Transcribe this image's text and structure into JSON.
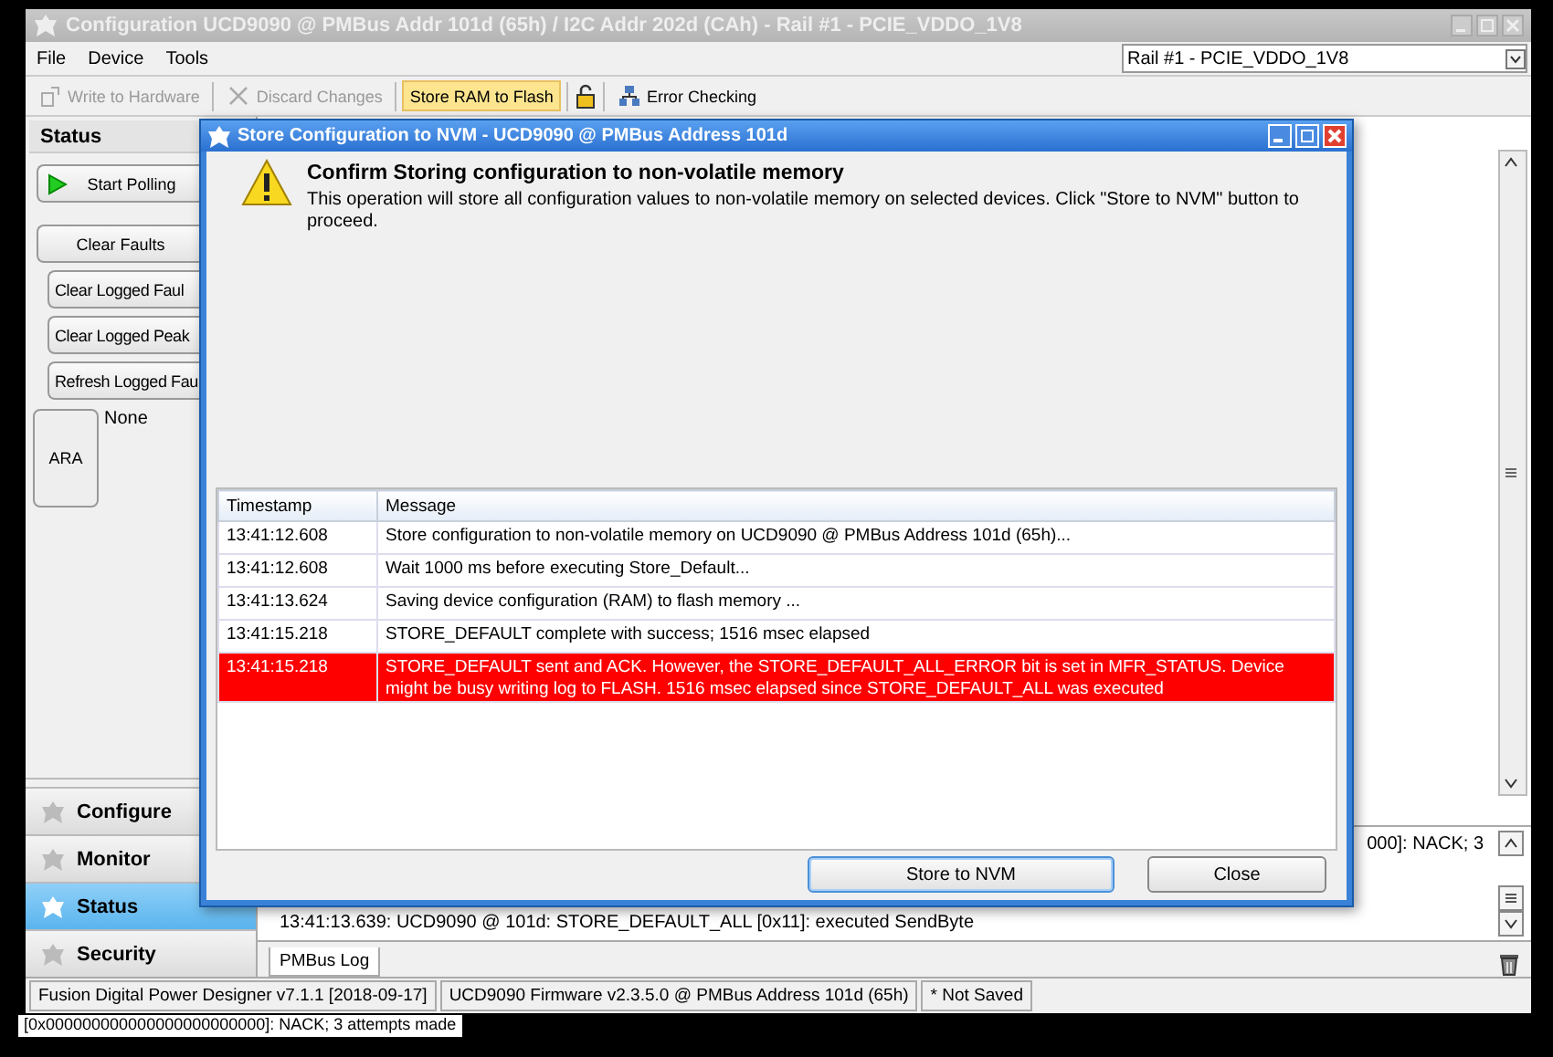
{
  "window": {
    "title": "Configuration UCD9090 @ PMBus Addr 101d (65h) / I2C Addr 202d (CAh) - Rail #1 - PCIE_VDDO_1V8"
  },
  "menu": [
    {
      "label": "File"
    },
    {
      "label": "Device"
    },
    {
      "label": "Tools"
    }
  ],
  "rail_select": {
    "value": "Rail #1 - PCIE_VDDO_1V8"
  },
  "toolbar": [
    {
      "kind": "button",
      "label": "Write to Hardware",
      "disabled": true,
      "highlighted": false
    },
    {
      "kind": "button",
      "label": "Discard Changes",
      "disabled": true,
      "highlighted": false
    },
    {
      "kind": "button",
      "label": "Store RAM to Flash",
      "disabled": false,
      "highlighted": true
    },
    {
      "kind": "icon"
    },
    {
      "kind": "button",
      "label": "Error Checking",
      "disabled": false,
      "highlighted": false
    }
  ],
  "status_panel": {
    "title": "Status",
    "buttons": [
      {
        "label": "Start Polling",
        "kind": "play"
      },
      {
        "label": "Clear Faults",
        "kind": "plain"
      },
      {
        "label": "Clear Logged Faul",
        "kind": "indented"
      },
      {
        "label": "Clear Logged Peak",
        "kind": "indented"
      },
      {
        "label": "Refresh Logged Fau",
        "kind": "indented"
      }
    ],
    "ara": {
      "label": "ARA",
      "value": "None"
    }
  },
  "nav": [
    {
      "label": "Configure",
      "selected": false
    },
    {
      "label": "Monitor",
      "selected": false
    },
    {
      "label": "Status",
      "selected": true
    },
    {
      "label": "Security",
      "selected": false
    }
  ],
  "log": {
    "lines": [
      "000]: NACK; 3",
      "13:41:13.639: UCD9090 @ 101d: STORE_DEFAULT_ALL [0x11]: executed SendByte"
    ],
    "tabs": [
      {
        "label": "PMBus Log",
        "selected": true
      }
    ]
  },
  "status_bar": [
    "Fusion Digital Power Designer v7.1.1 [2018-09-17]",
    "UCD9090 Firmware v2.3.5.0 @ PMBus Address 101d (65h)",
    "* Not Saved"
  ],
  "background_text": "[0x000000000000000000000000]: NACK; 3 attempts made",
  "dialog": {
    "title": "Store Configuration to NVM - UCD9090 @ PMBus Address 101d",
    "heading": "Confirm Storing configuration to non-volatile memory",
    "message": "This operation will store all configuration values to non-volatile memory on selected devices. Click \"Store to NVM\" button to proceed.",
    "table": {
      "columns": [
        "Timestamp",
        "Message"
      ],
      "rows": [
        {
          "timestamp": "13:41:12.608",
          "message": "Store configuration to non-volatile memory on UCD9090 @ PMBus Address 101d (65h)...",
          "error": false
        },
        {
          "timestamp": "13:41:12.608",
          "message": "Wait 1000 ms before executing Store_Default...",
          "error": false
        },
        {
          "timestamp": "13:41:13.624",
          "message": "Saving device configuration (RAM) to flash memory ...",
          "error": false
        },
        {
          "timestamp": "13:41:15.218",
          "message": "STORE_DEFAULT complete with success; 1516 msec elapsed",
          "error": false
        },
        {
          "timestamp": "13:41:15.218",
          "message": "STORE_DEFAULT sent and ACK. However, the STORE_DEFAULT_ALL_ERROR bit is set in MFR_STATUS. Device might be busy writing log to FLASH.  1516 msec elapsed since STORE_DEFAULT_ALL was executed",
          "error": true
        }
      ]
    },
    "buttons": [
      {
        "label": "Store to NVM",
        "focused": true
      },
      {
        "label": "Close",
        "focused": false
      }
    ]
  }
}
